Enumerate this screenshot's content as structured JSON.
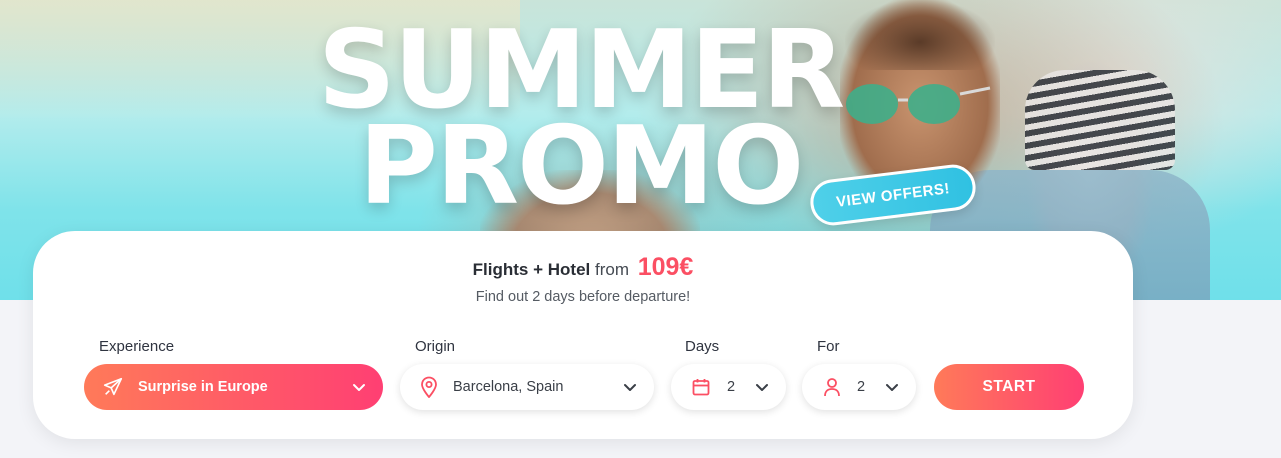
{
  "hero": {
    "headline_line1": "SUMMER",
    "headline_line2": "PROMO",
    "view_offers_label": "VIEW OFFERS!"
  },
  "promo": {
    "product": "Flights + Hotel",
    "from_text": "from",
    "price": "109€",
    "subtitle": "Find out 2 days before departure!"
  },
  "search": {
    "experience": {
      "label": "Experience",
      "value": "Surprise in Europe",
      "icon": "plane-icon"
    },
    "origin": {
      "label": "Origin",
      "value": "Barcelona, Spain",
      "icon": "map-pin-icon"
    },
    "days": {
      "label": "Days",
      "value": "2",
      "icon": "calendar-icon"
    },
    "travelers": {
      "label": "For",
      "value": "2",
      "icon": "person-icon"
    },
    "start_label": "START"
  },
  "colors": {
    "accent_gradient_start": "#ff7a59",
    "accent_gradient_end": "#ff3f73",
    "price": "#fb4f63",
    "view_offers": "#30c1e2"
  }
}
